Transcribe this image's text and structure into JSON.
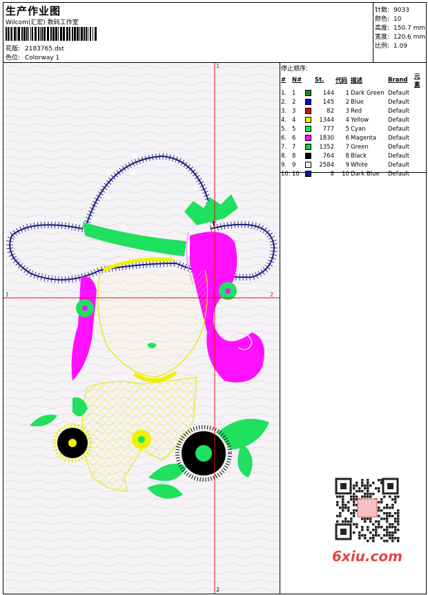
{
  "header": {
    "title": "生产作业图",
    "subtitle": "Wilcom(汇宏) 数码工作室",
    "design_label": "花版:",
    "design_value": "2183765.dst",
    "colorway_label": "色位:",
    "colorway_value": "Colorway 1"
  },
  "stats": {
    "stitches_label": "针数:",
    "stitches_value": "9033",
    "colors_label": "颜色:",
    "colors_value": "10",
    "height_label": "高度:",
    "height_value": "150.7 mm",
    "width_label": "宽度:",
    "width_value": "120.6 mm",
    "scale_label": "比例:",
    "scale_value": "1.09"
  },
  "design": {
    "marker_top": "1",
    "marker_left": "1",
    "marker_right": "2",
    "marker_bottom": "2"
  },
  "legend": {
    "heading": "停止顺序:",
    "columns": [
      "#",
      "N#",
      "St.",
      "代码",
      "描述",
      "Brand",
      "元素"
    ],
    "rows": [
      {
        "idx": "1.",
        "no": "1",
        "color": "#1a8a1a",
        "st": "144",
        "code": "1",
        "desc": "Dark Green",
        "brand": "Default"
      },
      {
        "idx": "2.",
        "no": "2",
        "color": "#0a0ad0",
        "st": "145",
        "code": "2",
        "desc": "Blue",
        "brand": "Default"
      },
      {
        "idx": "3.",
        "no": "3",
        "color": "#e01010",
        "st": "82",
        "code": "3",
        "desc": "Red",
        "brand": "Default"
      },
      {
        "idx": "4.",
        "no": "4",
        "color": "#f0f000",
        "st": "1344",
        "code": "4",
        "desc": "Yellow",
        "brand": "Default"
      },
      {
        "idx": "5.",
        "no": "5",
        "color": "#20e060",
        "st": "777",
        "code": "5",
        "desc": "Cyan",
        "brand": "Default"
      },
      {
        "idx": "6.",
        "no": "6",
        "color": "#ff10ff",
        "st": "1830",
        "code": "6",
        "desc": "Magenta",
        "brand": "Default"
      },
      {
        "idx": "7.",
        "no": "7",
        "color": "#10d040",
        "st": "1352",
        "code": "7",
        "desc": "Green",
        "brand": "Default"
      },
      {
        "idx": "8.",
        "no": "8",
        "color": "#000000",
        "st": "764",
        "code": "8",
        "desc": "Black",
        "brand": "Default"
      },
      {
        "idx": "9.",
        "no": "9",
        "color": "#f0f0f0",
        "st": "2584",
        "code": "9",
        "desc": "White",
        "brand": "Default"
      },
      {
        "idx": "10.",
        "no": "10",
        "color": "#0a1a90",
        "st": "8",
        "code": "10",
        "desc": "Dark Blue",
        "brand": "Default"
      }
    ]
  },
  "watermark": "6xiu.com",
  "colors": {
    "crosshair": "#e01010",
    "hat_outline": "#1a1a80",
    "hat_band": "#20e060",
    "hair": "#ff10ff",
    "face": "#f0f000",
    "leaves": "#20e060",
    "flower_center": "#000000",
    "watermark": "#e64545"
  }
}
